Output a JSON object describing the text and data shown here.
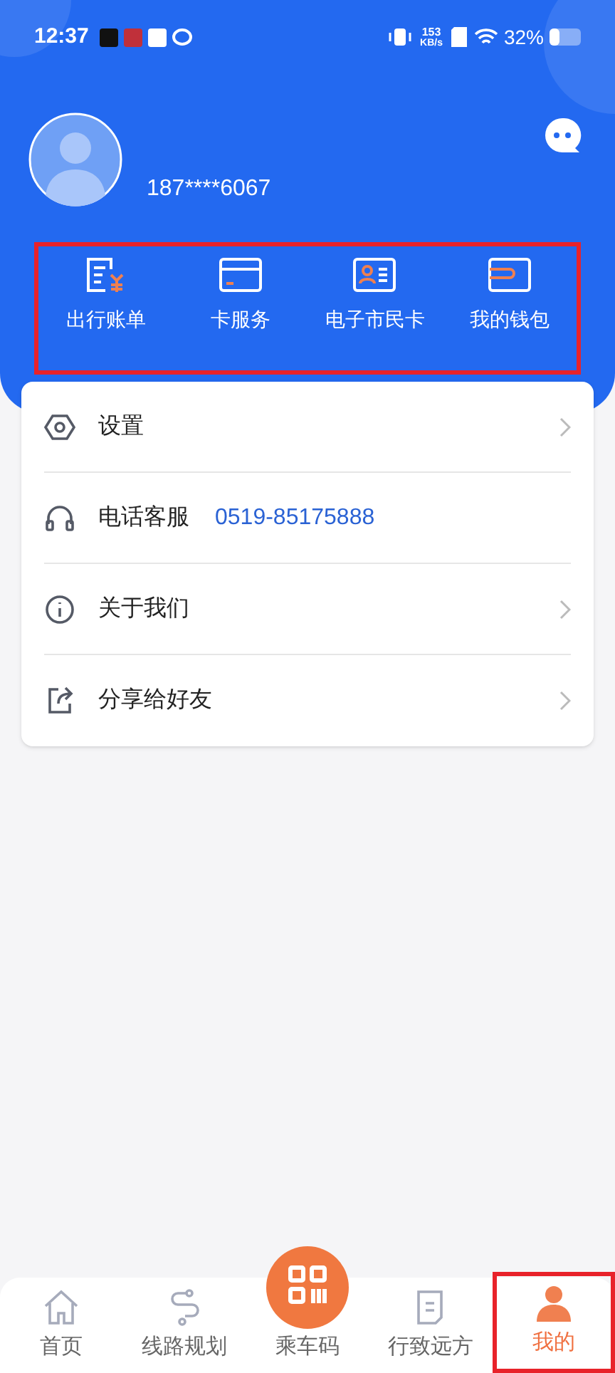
{
  "status_bar": {
    "time": "12:37",
    "net_speed_value": "153",
    "net_speed_unit": "KB/s",
    "battery": "32%"
  },
  "profile": {
    "phone": "187****6067"
  },
  "quick_actions": [
    {
      "kind": "bill",
      "label": "出行账单"
    },
    {
      "kind": "card",
      "label": "卡服务"
    },
    {
      "kind": "idcard",
      "label": "电子市民卡"
    },
    {
      "kind": "wallet",
      "label": "我的钱包"
    }
  ],
  "menu": [
    {
      "kind": "settings",
      "label": "设置",
      "chevron": true
    },
    {
      "kind": "phone",
      "label": "电话客服",
      "value": "0519-85175888",
      "chevron": false
    },
    {
      "kind": "about",
      "label": "关于我们",
      "chevron": true
    },
    {
      "kind": "share",
      "label": "分享给好友",
      "chevron": true
    }
  ],
  "bottom_nav": [
    {
      "kind": "home",
      "label": "首页",
      "selected": false
    },
    {
      "kind": "route",
      "label": "线路规划",
      "selected": false
    },
    {
      "kind": "qr",
      "label": "乘车码",
      "selected": false
    },
    {
      "kind": "travel",
      "label": "行致远方",
      "selected": false
    },
    {
      "kind": "me",
      "label": "我的",
      "selected": true
    }
  ]
}
